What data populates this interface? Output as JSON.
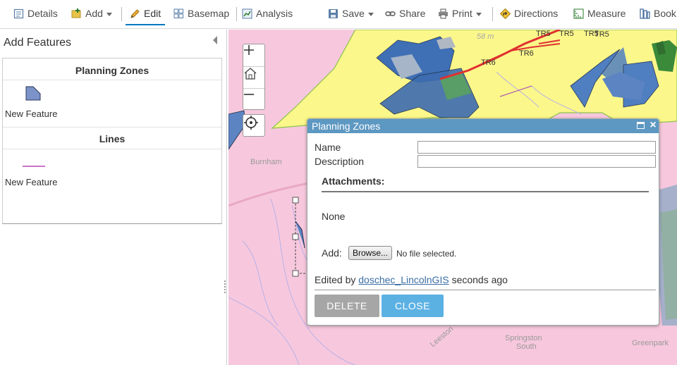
{
  "toolbar": {
    "details": "Details",
    "add": "Add",
    "edit": "Edit",
    "basemap": "Basemap",
    "analysis": "Analysis",
    "save": "Save",
    "share": "Share",
    "print": "Print",
    "directions": "Directions",
    "measure": "Measure",
    "bookmarks": "Book"
  },
  "panel": {
    "title": "Add Features",
    "groups": [
      {
        "header": "Planning Zones",
        "item_label": "New Feature",
        "symbol": "polygon",
        "fill": "#7b93c9"
      },
      {
        "header": "Lines",
        "item_label": "New Feature",
        "symbol": "line",
        "stroke": "#c873c9"
      }
    ]
  },
  "map": {
    "places": [
      "Burnham",
      "Springston",
      "South",
      "Greenpark",
      "Leeston"
    ],
    "tr_labels": [
      "TR5",
      "TR5",
      "TR5",
      "TR5",
      "TR6",
      "TR6"
    ],
    "scale_text": "58 m"
  },
  "popup": {
    "title": "Planning Zones",
    "fields": [
      {
        "label": "Name",
        "value": ""
      },
      {
        "label": "Description",
        "value": ""
      }
    ],
    "attachments_title": "Attachments:",
    "attachments_none": "None",
    "add_label": "Add:",
    "browse_label": "Browse...",
    "no_file": "No file selected.",
    "edited_prefix": "Edited by",
    "edited_user": "doschec_LincolnGIS",
    "edited_suffix": "seconds ago",
    "delete_label": "DELETE",
    "close_label": "CLOSE"
  },
  "colors": {
    "accent": "#0079c1",
    "popup_header": "#5d98c2",
    "close_button": "#5cb1e3",
    "delete_button": "#a6a6a6",
    "zone_pink": "#f7c8dd",
    "zone_yellow": "#fbf78a"
  }
}
